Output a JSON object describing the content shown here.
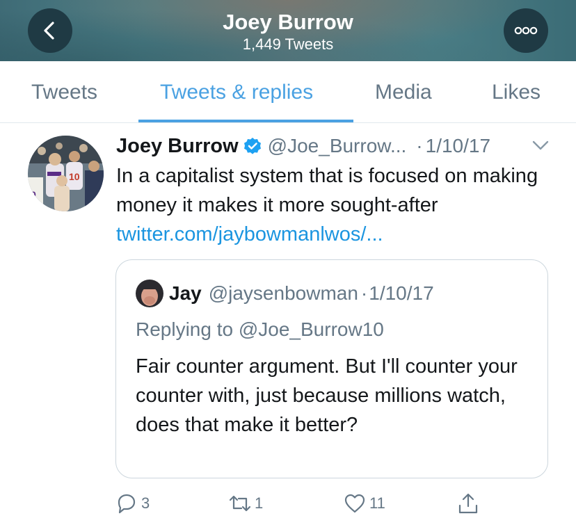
{
  "header": {
    "title": "Joey Burrow",
    "subtitle": "1,449 Tweets",
    "back_icon": "chevron-left-icon",
    "more_icon": "ellipsis-icon"
  },
  "tabs": [
    {
      "label": "Tweets",
      "active": false
    },
    {
      "label": "Tweets & replies",
      "active": true
    },
    {
      "label": "Media",
      "active": false
    },
    {
      "label": "Likes",
      "active": false
    }
  ],
  "tweet": {
    "author_name": "Joey Burrow",
    "verified": true,
    "handle": "@Joe_Burrow...",
    "separator": "·",
    "date": "1/10/17",
    "text": "In a capitalist system that is focused on making money it makes it more sought-after ",
    "link": "twitter.com/jaybowmanlwos/...",
    "quote": {
      "author_name": "Jay",
      "handle": "@jaysenbowman",
      "separator": "·",
      "date": "1/10/17",
      "replying_to": "Replying to @Joe_Burrow10",
      "text": "Fair counter argument. But I'll counter your counter with, just because millions watch, does that make it better?"
    },
    "actions": {
      "replies": "3",
      "retweets": "1",
      "likes": "11"
    }
  },
  "colors": {
    "accent": "#4aa1e2",
    "link": "#1b95e0",
    "secondary_text": "#657786",
    "primary_text": "#14171a",
    "header_button": "#1f3a44"
  }
}
